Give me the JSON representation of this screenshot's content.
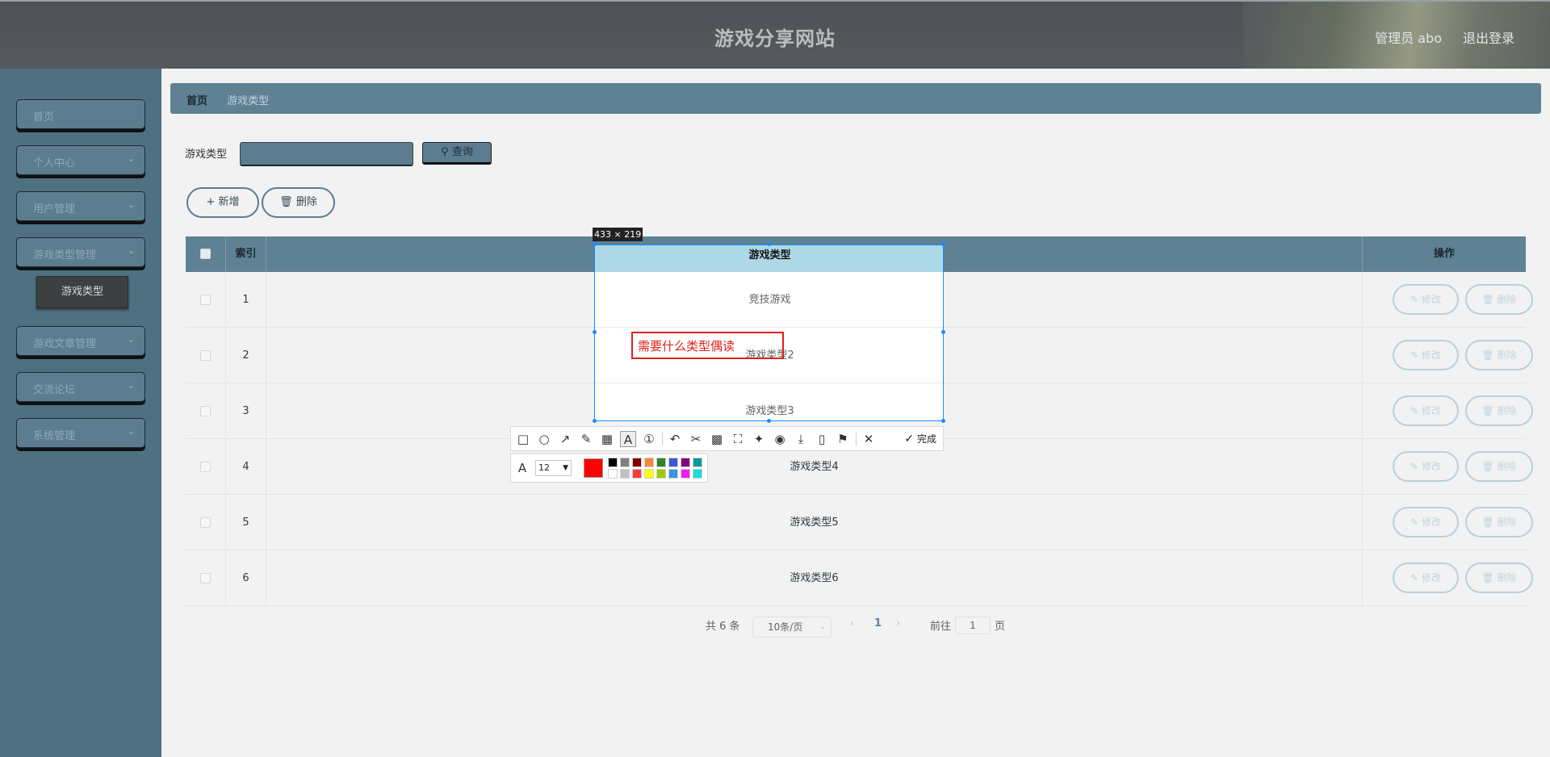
{
  "header": {
    "title": "游戏分享网站",
    "user": "管理员 abo",
    "logout": "退出登录"
  },
  "sidebar": {
    "items": [
      {
        "label": "首页",
        "has_arrow": false
      },
      {
        "label": "个人中心",
        "has_arrow": true
      },
      {
        "label": "用户管理",
        "has_arrow": true
      },
      {
        "label": "游戏类型管理",
        "has_arrow": true
      },
      {
        "label": "游戏文章管理",
        "has_arrow": true
      },
      {
        "label": "交流论坛",
        "has_arrow": true
      },
      {
        "label": "系统管理",
        "has_arrow": true
      }
    ],
    "active_sub": "游戏类型"
  },
  "breadcrumb": {
    "home": "首页",
    "current": "游戏类型"
  },
  "search": {
    "label": "游戏类型",
    "value": "",
    "button": "查询"
  },
  "actions": {
    "add": "新增",
    "delete": "删除"
  },
  "table": {
    "headers": {
      "index": "索引",
      "type": "游戏类型",
      "ops": "操作"
    },
    "rows": [
      {
        "index": "1",
        "type": "竞技游戏"
      },
      {
        "index": "2",
        "type": "游戏类型2"
      },
      {
        "index": "3",
        "type": "游戏类型3"
      },
      {
        "index": "4",
        "type": "游戏类型4"
      },
      {
        "index": "5",
        "type": "游戏类型5"
      },
      {
        "index": "6",
        "type": "游戏类型6"
      }
    ],
    "edit_label": "修改",
    "delete_label": "删除"
  },
  "pagination": {
    "total": "共 6 条",
    "page_size": "10条/页",
    "current_page": "1",
    "goto_label": "前往",
    "goto_value": "1",
    "page_unit": "页"
  },
  "screenshot_tool": {
    "size_label": "433 × 219",
    "annotation_text": "需要什么类型偶读",
    "done_label": "完成",
    "font_size": "12",
    "current_color": "#ff0000",
    "palette": [
      "#000000",
      "#808080",
      "#800000",
      "#f7883a",
      "#308430",
      "#385ad3",
      "#800080",
      "#009999",
      "#ffffff",
      "#c0c0c0",
      "#fb3838",
      "#ffff00",
      "#99cc00",
      "#3894e4",
      "#f31bf3",
      "#16dcdc"
    ]
  }
}
